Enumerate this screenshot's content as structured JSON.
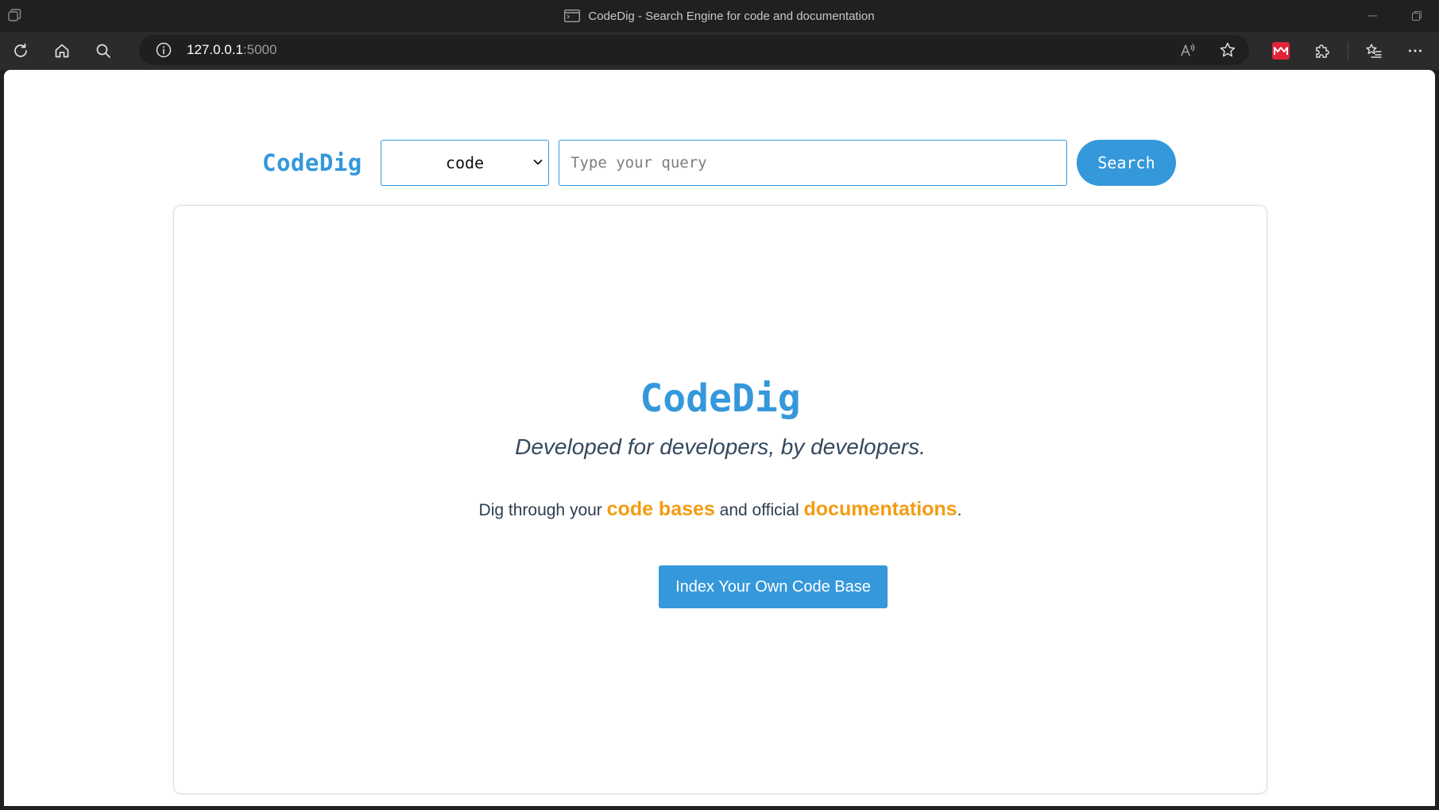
{
  "window": {
    "title": "CodeDig - Search Engine for code and documentation"
  },
  "browser": {
    "url_host": "127.0.0.1",
    "url_port": ":5000",
    "extension_badge_color": "#e0243a"
  },
  "header": {
    "brand": "CodeDig",
    "select_value": "code",
    "search_placeholder": "Type your query",
    "search_value": "",
    "search_button": "Search"
  },
  "hero": {
    "title": "CodeDig",
    "subtitle": "Developed for developers, by developers.",
    "desc_prefix": "Dig through your ",
    "desc_highlight1": "code bases",
    "desc_middle": " and official ",
    "desc_highlight2": "documentations",
    "desc_suffix": ".",
    "button_label": "Index Your Own Code Base"
  },
  "colors": {
    "accent": "#3498db",
    "highlight": "#f39c12",
    "text_dark": "#2c3e50",
    "chrome_bg": "#202020"
  },
  "icons": {
    "titlebar": [
      "tab-actions-icon",
      "page-icon",
      "minimize-icon",
      "restore-icon"
    ],
    "toolbar": [
      "refresh-icon",
      "home-icon",
      "search-icon",
      "info-icon",
      "read-aloud-icon",
      "favorite-star-icon",
      "extension-icon",
      "extensions-puzzle-icon",
      "favorites-icon",
      "more-icon"
    ]
  }
}
